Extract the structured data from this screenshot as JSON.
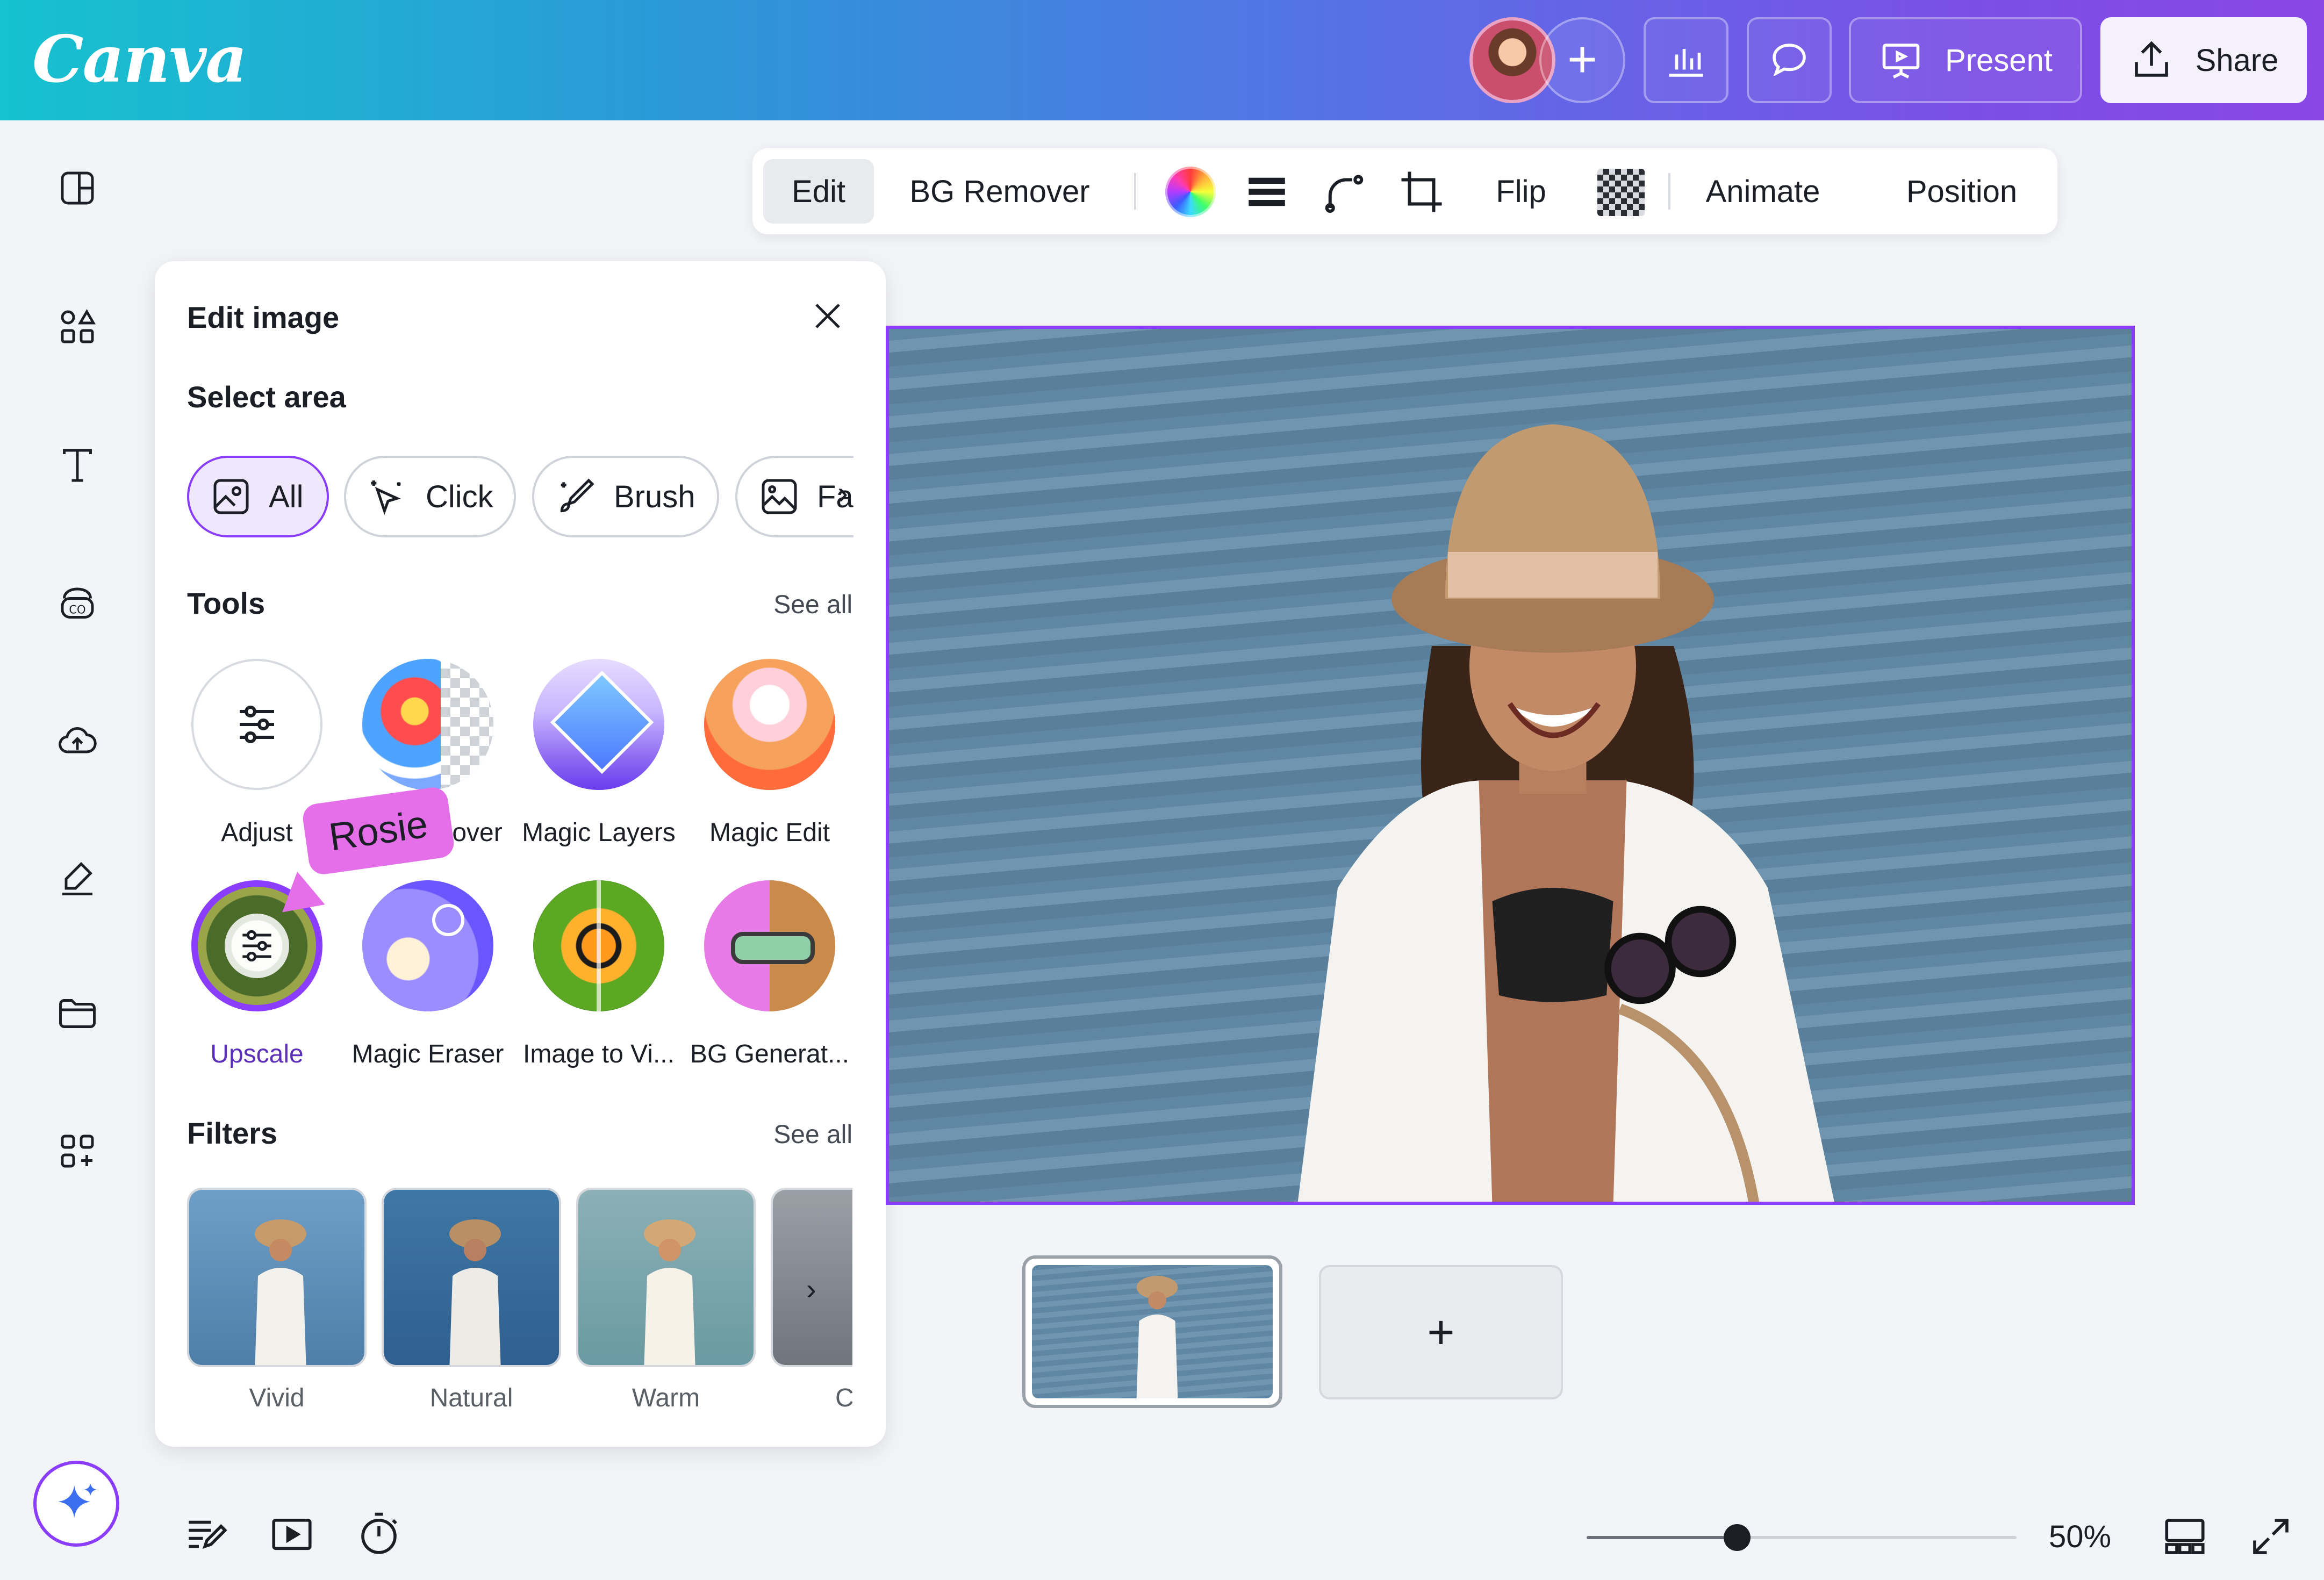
{
  "app": {
    "logo": "Canva"
  },
  "header": {
    "present_label": "Present",
    "share_label": "Share"
  },
  "toolbar": {
    "edit": "Edit",
    "bg_remover": "BG Remover",
    "flip": "Flip",
    "animate": "Animate",
    "position": "Position"
  },
  "panel": {
    "title": "Edit image",
    "select_area": {
      "label": "Select area",
      "chips": [
        "All",
        "Click",
        "Brush",
        "Fa"
      ]
    },
    "tools": {
      "label": "Tools",
      "see_all": "See all",
      "items": [
        "Adjust",
        "BG Remover",
        "Magic Layers",
        "Magic Edit",
        "Upscale",
        "Magic Eraser",
        "Image to Vi...",
        "BG Generat..."
      ]
    },
    "filters": {
      "label": "Filters",
      "see_all": "See all",
      "items": [
        "Vivid",
        "Natural",
        "Warm",
        "C"
      ]
    }
  },
  "cursor_tag": "Rosie",
  "pages": {
    "add_label": "+"
  },
  "zoom": {
    "label": "50%",
    "value_fraction": 0.5
  },
  "colors": {
    "accent": "#8b3dff",
    "cursor_tag": "#e56ee9"
  }
}
